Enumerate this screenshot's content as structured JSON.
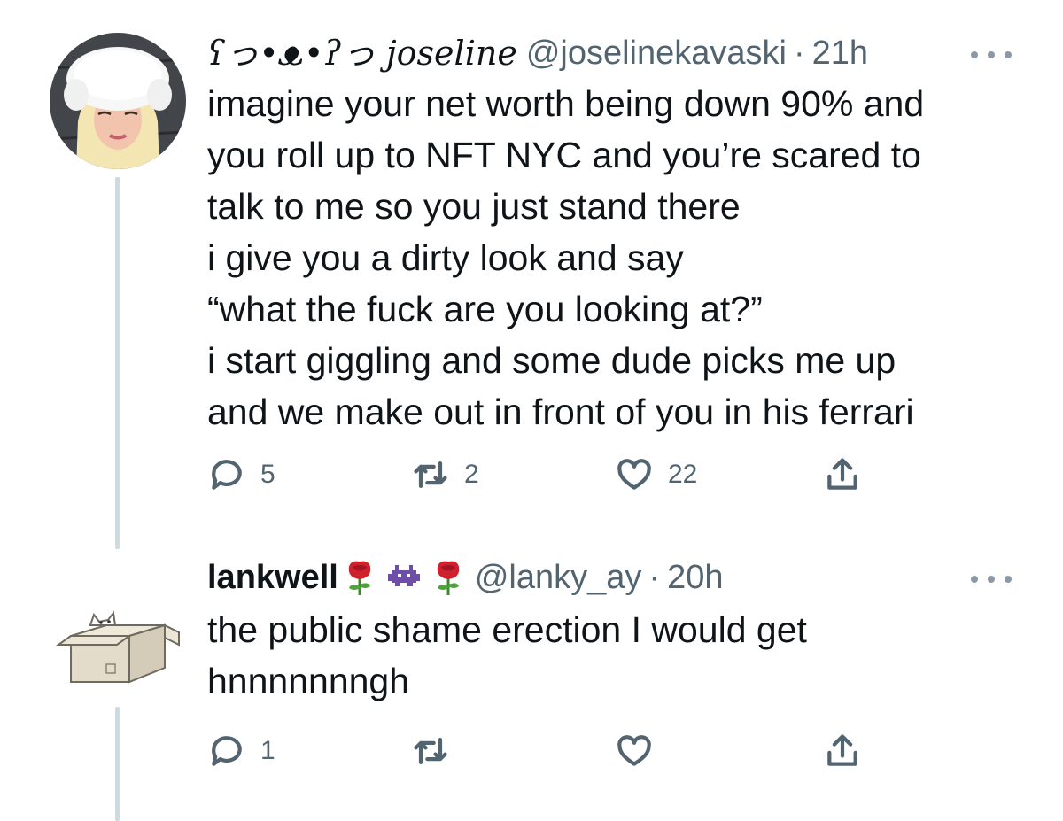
{
  "tweets": [
    {
      "display_name": "ʕっ•ᴥ•ʔっ joseline",
      "handle": "@joselinekavaski",
      "separator": "·",
      "time": "21h",
      "text": "imagine your net worth being down 90% and\nyou roll up to NFT NYC and you’re scared to\ntalk to me so you just stand there\ni give you a dirty look and say\n“what the fuck are you looking at?”\ni start giggling and some dude picks me up\nand we make out in front of you in his ferrari",
      "reply_count": "5",
      "retweet_count": "2",
      "like_count": "22",
      "share_count": ""
    },
    {
      "display_name": "lankwell",
      "name_emojis": [
        "rose-emoji",
        "alien-monster-emoji",
        "rose-emoji"
      ],
      "handle": "@lanky_ay",
      "separator": "·",
      "time": "20h",
      "text": "the public shame erection I would get\nhnnnnnnngh",
      "reply_count": "1",
      "retweet_count": "",
      "like_count": "",
      "share_count": ""
    }
  ],
  "colors": {
    "text": "#0f1419",
    "secondary": "#536471",
    "thread_line": "#cfd9de",
    "rose": "#d0202e",
    "invader": "#6e4ea8"
  }
}
